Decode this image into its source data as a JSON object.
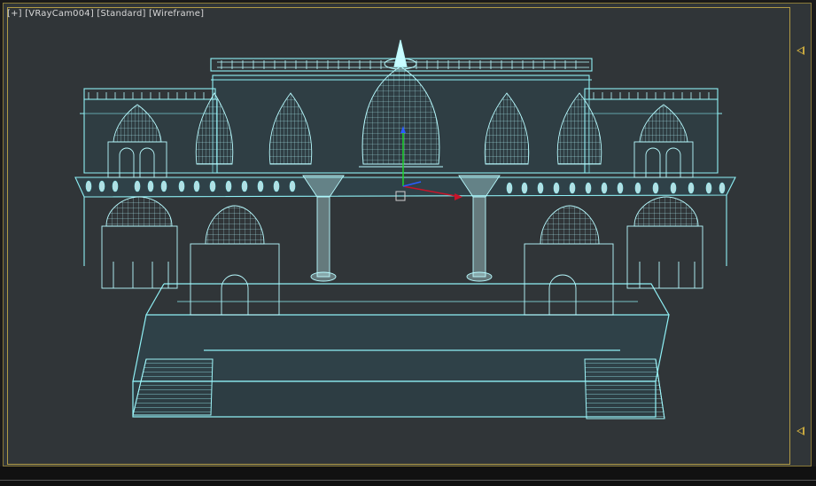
{
  "viewport": {
    "label_parts": [
      "[+]",
      "[VRayCam004]",
      "[Standard]",
      "[Wireframe]"
    ]
  },
  "scene": {
    "wire_color": "#8ff0f5",
    "bright_color": "#c9fbff",
    "floor_color": "#2f4b55",
    "bg_color": "#303538",
    "frame_color": "#b09a45",
    "axis_x_color": "#c8142a",
    "axis_y_color": "#1fd42c",
    "axis_z_color": "#2a5cff"
  },
  "icons": {
    "marker_top": "triangle-left-marker-icon",
    "marker_bottom": "triangle-left-marker-icon"
  }
}
